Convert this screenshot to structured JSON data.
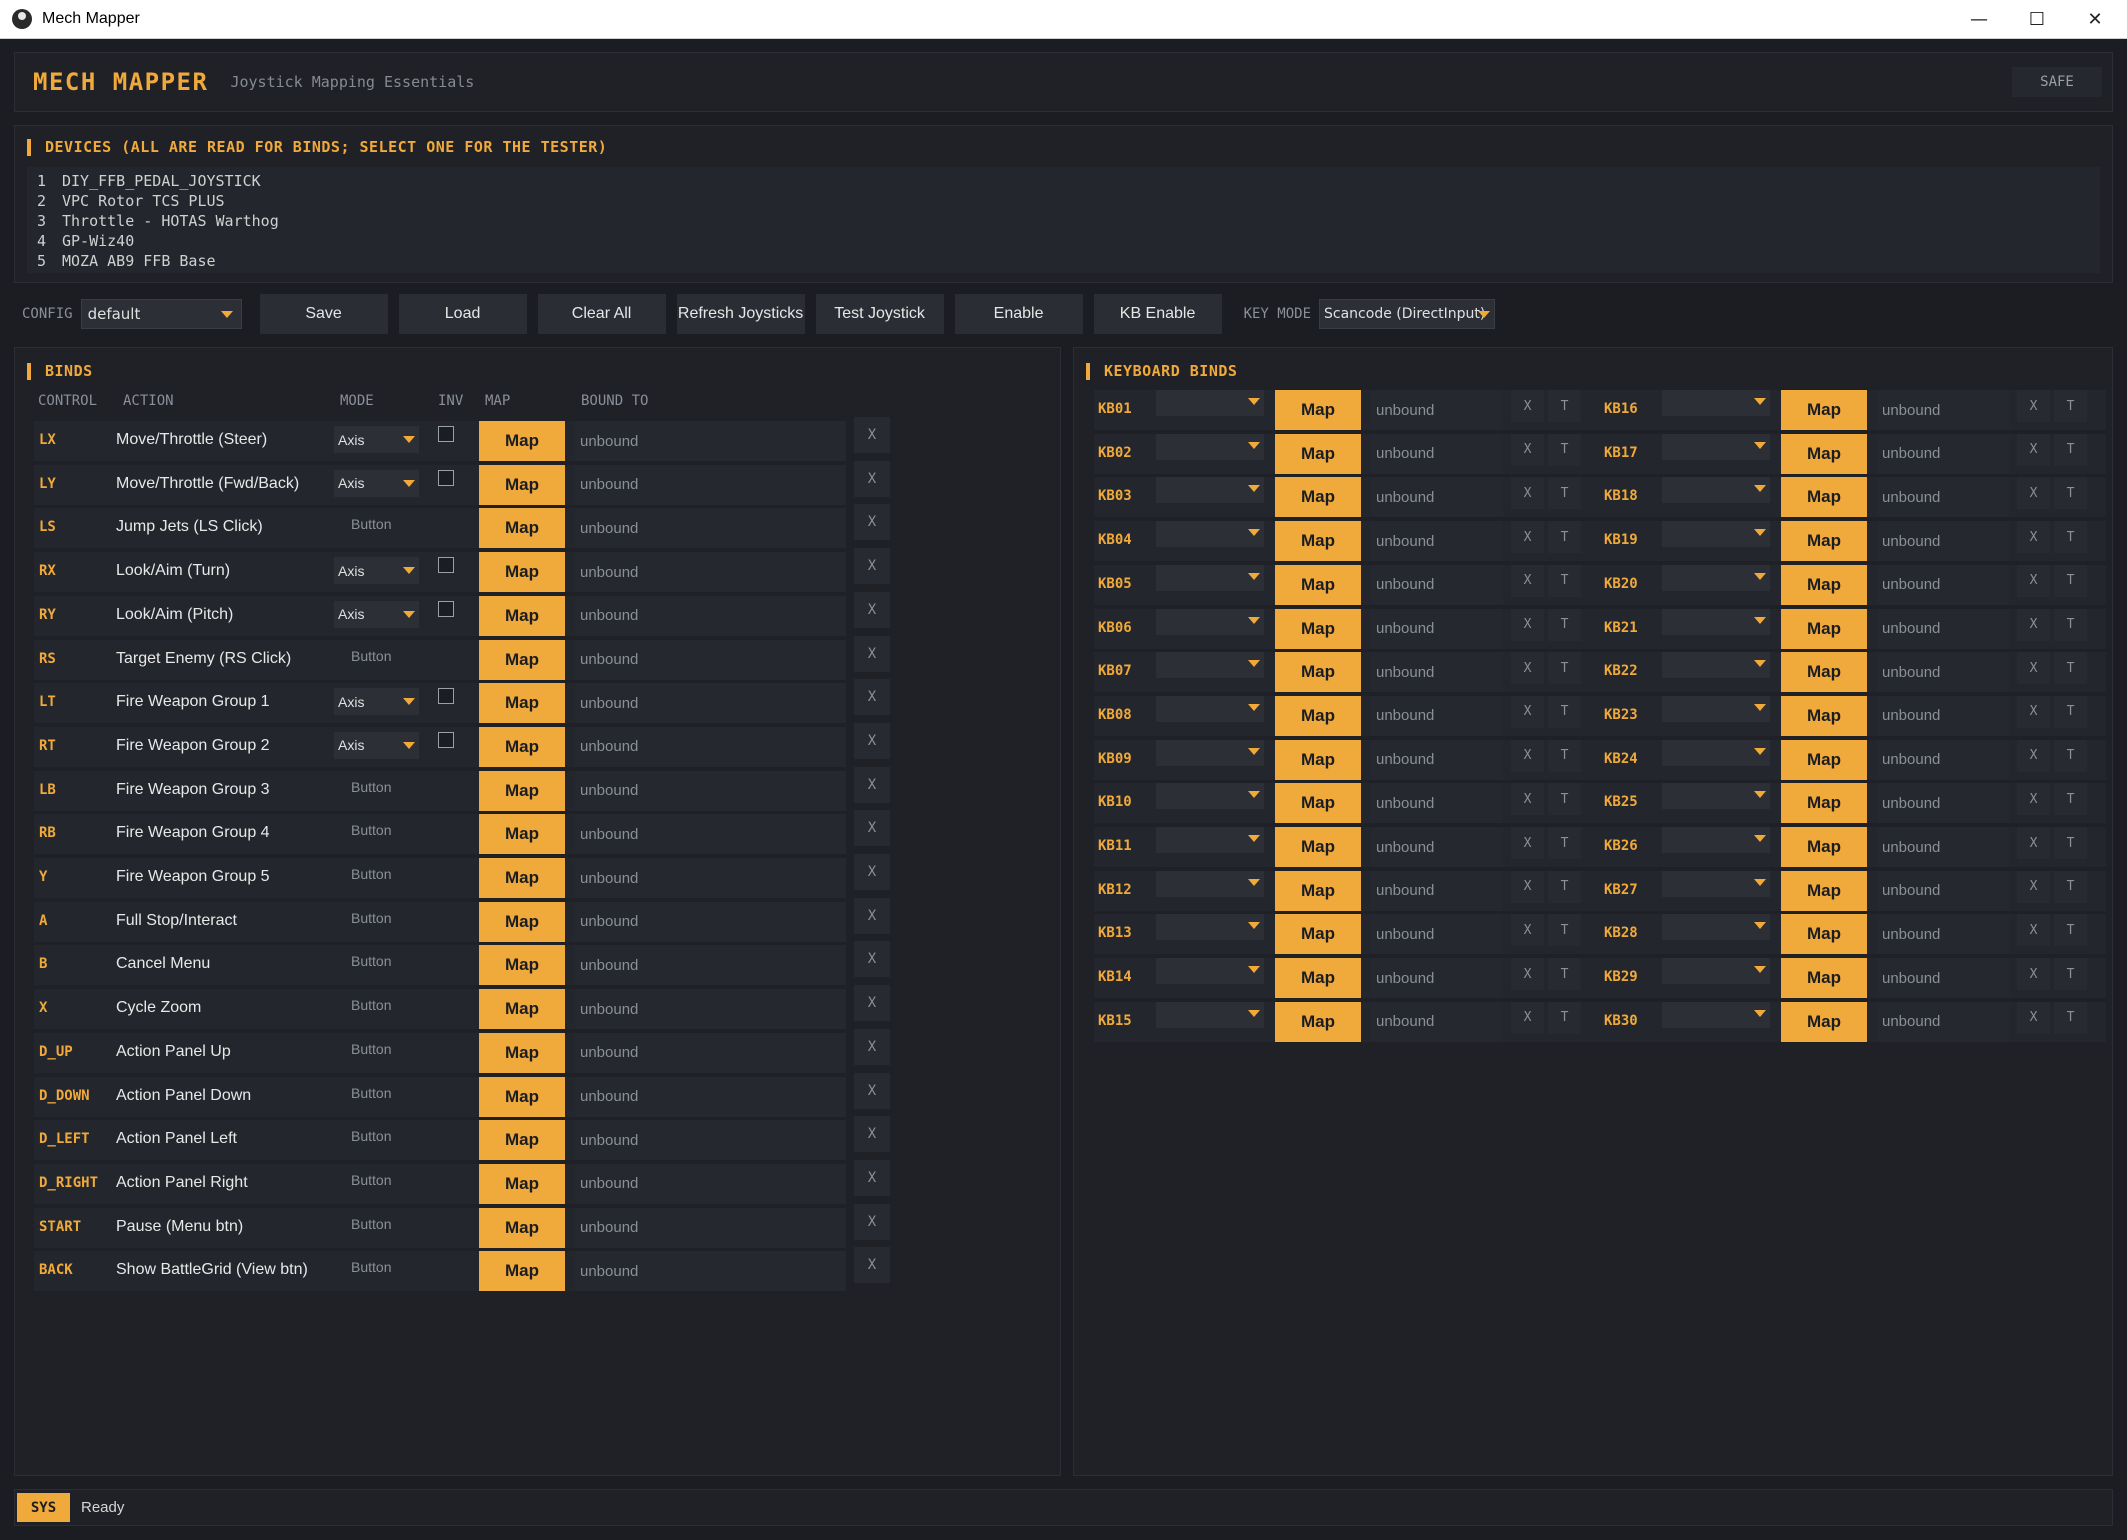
{
  "window": {
    "title": "Mech Mapper",
    "controls": [
      "—",
      "☐",
      "✕"
    ]
  },
  "header": {
    "logo": "MECH MAPPER",
    "subtitle": "Joystick Mapping Essentials",
    "badge": "SAFE"
  },
  "devices": {
    "title": "DEVICES  (ALL ARE READ FOR BINDS; SELECT ONE FOR THE TESTER)",
    "items": [
      {
        "num": "1",
        "name": "DIY_FFB_PEDAL_JOYSTICK"
      },
      {
        "num": "2",
        "name": "VPC Rotor TCS PLUS"
      },
      {
        "num": "3",
        "name": "Throttle - HOTAS Warthog"
      },
      {
        "num": "4",
        "name": "GP-Wiz40"
      },
      {
        "num": "5",
        "name": "MOZA AB9 FFB Base"
      }
    ]
  },
  "toolbar": {
    "config_label": "CONFIG",
    "config_value": "default",
    "buttons": [
      "Save",
      "Load",
      "Clear All",
      "Refresh Joysticks",
      "Test Joystick",
      "Enable",
      "KB Enable"
    ],
    "keymode_label": "KEY MODE",
    "keymode_value": "Scancode (DirectInput)"
  },
  "binds": {
    "title": "BINDS",
    "headers": {
      "control": "CONTROL",
      "action": "ACTION",
      "mode": "MODE",
      "inv": "INV",
      "map": "MAP",
      "bound": "BOUND TO"
    },
    "map_label": "Map",
    "clear_label": "X",
    "rows": [
      {
        "control": "LX",
        "action": "Move/Throttle (Steer)",
        "mode": "Axis",
        "bound": "unbound"
      },
      {
        "control": "LY",
        "action": "Move/Throttle (Fwd/Back)",
        "mode": "Axis",
        "bound": "unbound"
      },
      {
        "control": "LS",
        "action": "Jump Jets (LS Click)",
        "mode": "Button",
        "bound": "unbound"
      },
      {
        "control": "RX",
        "action": "Look/Aim (Turn)",
        "mode": "Axis",
        "bound": "unbound"
      },
      {
        "control": "RY",
        "action": "Look/Aim (Pitch)",
        "mode": "Axis",
        "bound": "unbound"
      },
      {
        "control": "RS",
        "action": "Target Enemy (RS Click)",
        "mode": "Button",
        "bound": "unbound"
      },
      {
        "control": "LT",
        "action": "Fire Weapon Group 1",
        "mode": "Axis",
        "bound": "unbound"
      },
      {
        "control": "RT",
        "action": "Fire Weapon Group 2",
        "mode": "Axis",
        "bound": "unbound"
      },
      {
        "control": "LB",
        "action": "Fire Weapon Group 3",
        "mode": "Button",
        "bound": "unbound"
      },
      {
        "control": "RB",
        "action": "Fire Weapon Group 4",
        "mode": "Button",
        "bound": "unbound"
      },
      {
        "control": "Y",
        "action": "Fire Weapon Group 5",
        "mode": "Button",
        "bound": "unbound"
      },
      {
        "control": "A",
        "action": "Full Stop/Interact",
        "mode": "Button",
        "bound": "unbound"
      },
      {
        "control": "B",
        "action": "Cancel Menu",
        "mode": "Button",
        "bound": "unbound"
      },
      {
        "control": "X",
        "action": "Cycle Zoom",
        "mode": "Button",
        "bound": "unbound"
      },
      {
        "control": "D_UP",
        "action": "Action Panel Up",
        "mode": "Button",
        "bound": "unbound"
      },
      {
        "control": "D_DOWN",
        "action": "Action Panel Down",
        "mode": "Button",
        "bound": "unbound"
      },
      {
        "control": "D_LEFT",
        "action": "Action Panel Left",
        "mode": "Button",
        "bound": "unbound"
      },
      {
        "control": "D_RIGHT",
        "action": "Action Panel Right",
        "mode": "Button",
        "bound": "unbound"
      },
      {
        "control": "START",
        "action": "Pause (Menu btn)",
        "mode": "Button",
        "bound": "unbound"
      },
      {
        "control": "BACK",
        "action": "Show BattleGrid (View btn)",
        "mode": "Button",
        "bound": "unbound"
      }
    ]
  },
  "keyboard": {
    "title": "KEYBOARD BINDS",
    "map_label": "Map",
    "x_label": "X",
    "t_label": "T",
    "rows": [
      {
        "label": "KB01",
        "bound": "unbound"
      },
      {
        "label": "KB02",
        "bound": "unbound"
      },
      {
        "label": "KB03",
        "bound": "unbound"
      },
      {
        "label": "KB04",
        "bound": "unbound"
      },
      {
        "label": "KB05",
        "bound": "unbound"
      },
      {
        "label": "KB06",
        "bound": "unbound"
      },
      {
        "label": "KB07",
        "bound": "unbound"
      },
      {
        "label": "KB08",
        "bound": "unbound"
      },
      {
        "label": "KB09",
        "bound": "unbound"
      },
      {
        "label": "KB10",
        "bound": "unbound"
      },
      {
        "label": "KB11",
        "bound": "unbound"
      },
      {
        "label": "KB12",
        "bound": "unbound"
      },
      {
        "label": "KB13",
        "bound": "unbound"
      },
      {
        "label": "KB14",
        "bound": "unbound"
      },
      {
        "label": "KB15",
        "bound": "unbound"
      },
      {
        "label": "KB16",
        "bound": "unbound"
      },
      {
        "label": "KB17",
        "bound": "unbound"
      },
      {
        "label": "KB18",
        "bound": "unbound"
      },
      {
        "label": "KB19",
        "bound": "unbound"
      },
      {
        "label": "KB20",
        "bound": "unbound"
      },
      {
        "label": "KB21",
        "bound": "unbound"
      },
      {
        "label": "KB22",
        "bound": "unbound"
      },
      {
        "label": "KB23",
        "bound": "unbound"
      },
      {
        "label": "KB24",
        "bound": "unbound"
      },
      {
        "label": "KB25",
        "bound": "unbound"
      },
      {
        "label": "KB26",
        "bound": "unbound"
      },
      {
        "label": "KB27",
        "bound": "unbound"
      },
      {
        "label": "KB28",
        "bound": "unbound"
      },
      {
        "label": "KB29",
        "bound": "unbound"
      },
      {
        "label": "KB30",
        "bound": "unbound"
      }
    ]
  },
  "status": {
    "tag": "SYS",
    "message": "Ready"
  },
  "colors": {
    "accent": "#f0a93b",
    "background": "#1b1d22",
    "panel": "#1f2127"
  }
}
